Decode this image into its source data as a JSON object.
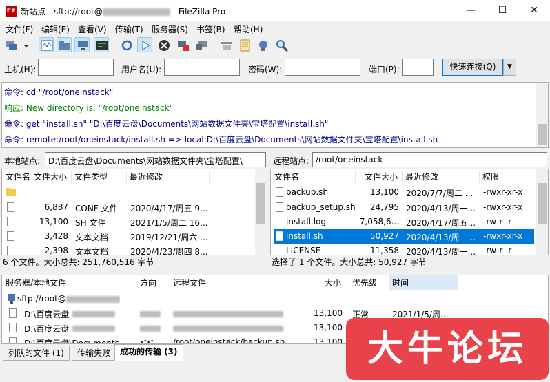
{
  "titlebar": {
    "prefix": "新站点 - sftp://root@",
    "suffix": " - FileZilla Pro",
    "min": "—",
    "max": "☐",
    "close": "✕"
  },
  "menu": [
    "文件(F)",
    "编辑(E)",
    "查看(V)",
    "传输(T)",
    "服务器(S)",
    "书签(B)",
    "帮助(H)"
  ],
  "quickconnect": {
    "host_label": "主机(H):",
    "user_label": "用户名(U):",
    "pass_label": "密码(W):",
    "port_label": "端口(P):",
    "button": "快速连接(Q)",
    "dropdown": "▼"
  },
  "log": [
    {
      "prefix": "命令:",
      "text": "cd \"/root/oneinstack\"",
      "color": "#000080"
    },
    {
      "prefix": "响应:",
      "text": "New directory is: \"/root/oneinstack\"",
      "color": "#008000"
    },
    {
      "prefix": "命令:",
      "text": "get \"install.sh\" \"D:\\百度云盘\\Documents\\网站数据文件夹\\宝塔配置\\install.sh\"",
      "color": "#000080"
    },
    {
      "prefix": "命令:",
      "text": "remote:/root/oneinstack/install.sh => local:D:\\百度云盘\\Documents\\网站数据文件夹\\宝塔配置\\install.sh",
      "color": "#000080"
    }
  ],
  "local": {
    "label": "本地站点:",
    "path": "D:\\百度云盘\\Documents\\网站数据文件夹\\宝塔配置\\",
    "headers": [
      "文件名",
      "文件大小",
      "文件类型",
      "最近修改"
    ],
    "rows": [
      {
        "name": "..",
        "size": "",
        "type": "",
        "date": ""
      },
      {
        "name": "",
        "size": "6,887",
        "type": "CONF 文件",
        "date": "2020/4/17/周五 9..."
      },
      {
        "name": "",
        "size": "13,100",
        "type": "SH 文件",
        "date": "2021/1/5/周二 16..."
      },
      {
        "name": "",
        "size": "3,428",
        "type": "文本文档",
        "date": "2019/12/21/周六 ..."
      },
      {
        "name": "",
        "size": "2,398",
        "type": "文本文档",
        "date": "2020/4/23/周四 8..."
      }
    ],
    "status": "6 个文件。大小总共: 251,760,516 字节"
  },
  "remote": {
    "label": "远程站点:",
    "path": "/root/oneinstack",
    "headers": [
      "文件名",
      "文件大小",
      "最近修改",
      "权限"
    ],
    "rows": [
      {
        "name": "backup.sh",
        "size": "13,100",
        "date": "2020/7/7/周二 ...",
        "perm": "-rwxr-xr-x"
      },
      {
        "name": "backup_setup.sh",
        "size": "24,795",
        "date": "2020/4/13/周一...",
        "perm": "-rwxr-xr-x"
      },
      {
        "name": "install.log",
        "size": "7,058,6...",
        "date": "2020/4/17/周五...",
        "perm": "-rw-r--r--"
      },
      {
        "name": "install.sh",
        "size": "50,927",
        "date": "2020/4/13/周一...",
        "perm": "-rwxr-xr-x"
      },
      {
        "name": "LICENSE",
        "size": "11,358",
        "date": "2020/4/13/周一...",
        "perm": "-rw-r--r--"
      }
    ],
    "status": "选择了 1 个文件。大小总共: 50,927 字节"
  },
  "queue": {
    "headers": [
      "服务器/本地文件",
      "方向",
      "远程文件",
      "大小",
      "优先级",
      "时间"
    ],
    "server": "sftp://root@",
    "rows": [
      {
        "local": "D:\\百度云盘",
        "dir": "",
        "remote": "",
        "size": "13,100",
        "priority": "正常",
        "time": "2021/1/5/周..."
      },
      {
        "local": "D:\\百度云盘",
        "dir": "",
        "remote": "",
        "size": "13,100",
        "priority": "",
        "time": ""
      },
      {
        "local": "D:\\百度云盘\\Documents...",
        "dir": "<<",
        "remote": "/root/oneinstack/backup.sh",
        "size": "13,100",
        "priority": "",
        "time": ""
      }
    ],
    "tabs": [
      "列队的文件 (1)",
      "传输失败",
      "成功的传输 (3)"
    ]
  },
  "watermark": "大牛论坛"
}
